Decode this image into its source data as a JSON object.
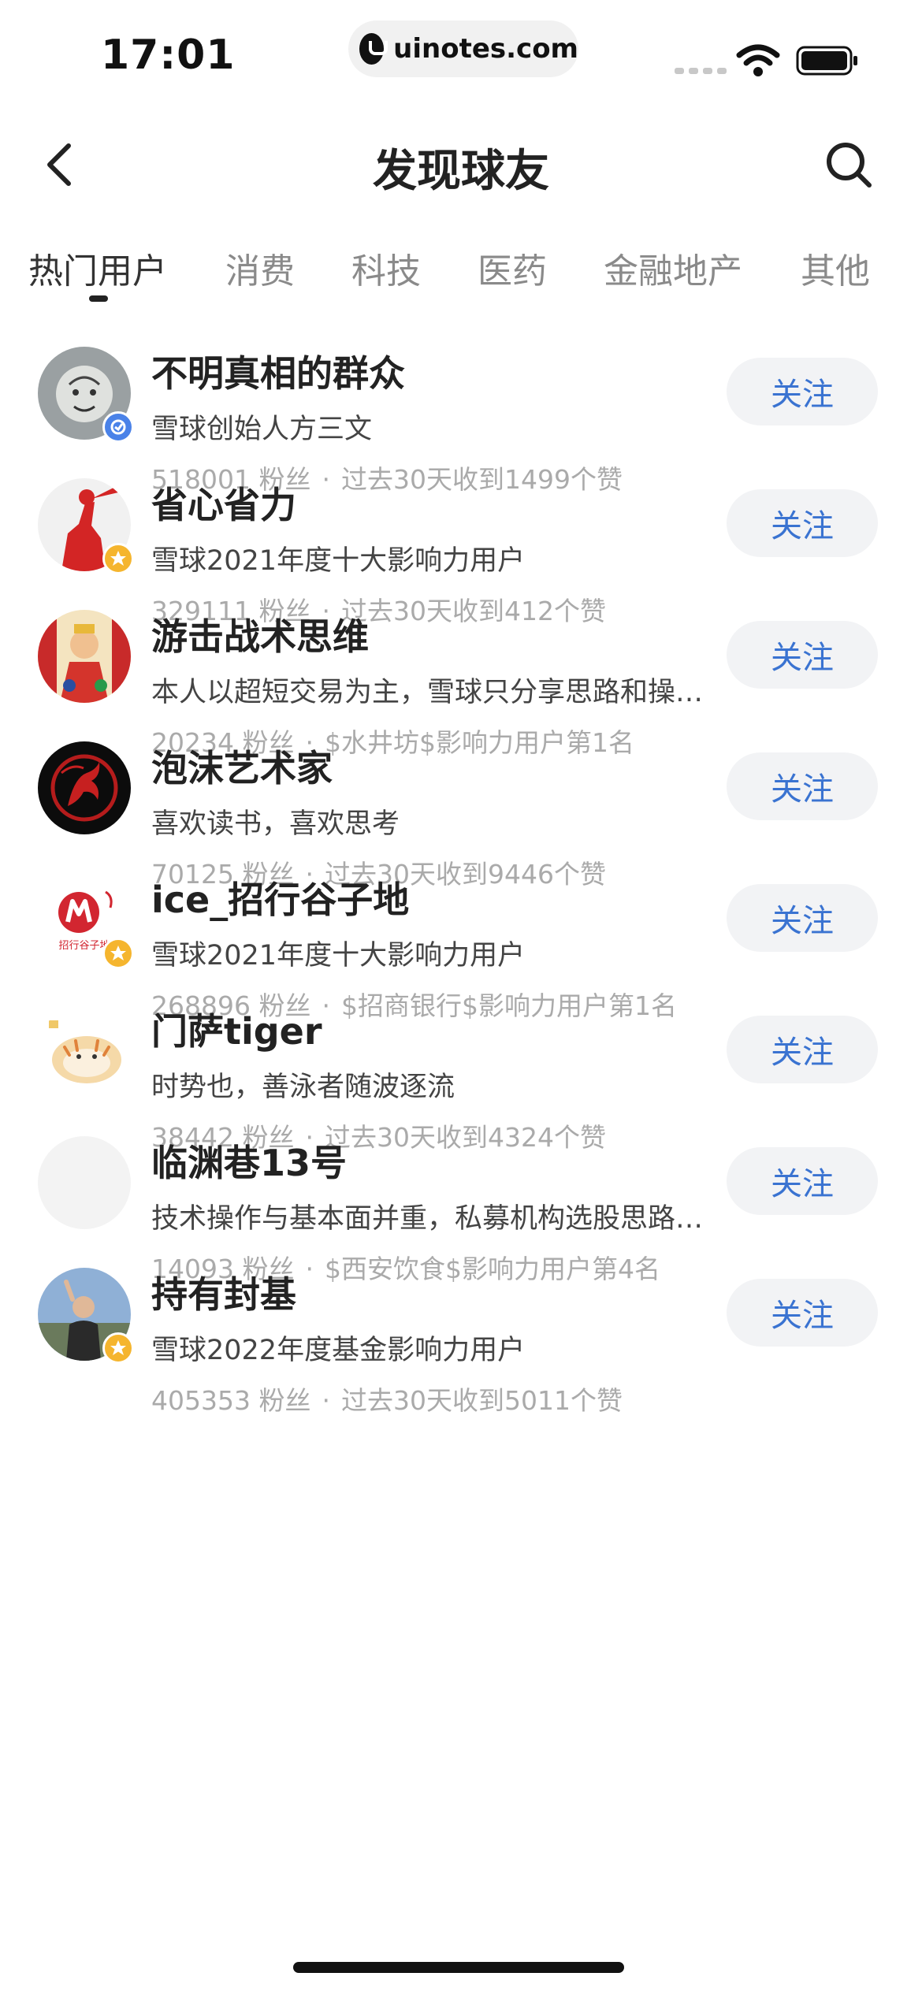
{
  "status_bar": {
    "time": "17:01",
    "url": "uinotes.com"
  },
  "nav": {
    "title": "发现球友"
  },
  "tabs": [
    {
      "label": "热门用户",
      "active": true
    },
    {
      "label": "消费",
      "active": false
    },
    {
      "label": "科技",
      "active": false
    },
    {
      "label": "医药",
      "active": false
    },
    {
      "label": "金融地产",
      "active": false
    },
    {
      "label": "其他",
      "active": false
    }
  ],
  "follow_label": "关注",
  "fans_unit": "粉丝",
  "users": [
    {
      "name": "不明真相的群众",
      "desc": "雪球创始人方三文",
      "fans": "518001",
      "meta": "过去30天收到1499个赞",
      "badge": "verified",
      "avatar": "sketch-face"
    },
    {
      "name": "省心省力",
      "desc": "雪球2021年度十大影响力用户",
      "fans": "329111",
      "meta": "过去30天收到412个赞",
      "badge": "star",
      "avatar": "red-figure"
    },
    {
      "name": "游击战术思维",
      "desc": "本人以超短交易为主，雪球只分享思路和操作，不做任何推荐",
      "fans": "20234",
      "meta": "$水井坊$影响力用户第1名",
      "badge": "",
      "avatar": "colorful-art"
    },
    {
      "name": "泡沫艺术家",
      "desc": "喜欢读书，喜欢思考",
      "fans": "70125",
      "meta": "过去30天收到9446个赞",
      "badge": "",
      "avatar": "red-bird"
    },
    {
      "name": "ice_招行谷子地",
      "desc": "雪球2021年度十大影响力用户",
      "fans": "268896",
      "meta": "$招商银行$影响力用户第1名",
      "badge": "star",
      "avatar": "cmb-logo",
      "avatar_text": "招行谷子地"
    },
    {
      "name": "门萨tiger",
      "desc": "时势也，善泳者随波逐流",
      "fans": "38442",
      "meta": "过去30天收到4324个赞",
      "badge": "",
      "avatar": "tiger"
    },
    {
      "name": "临渊巷13号",
      "desc": "技术操作与基本面并重，私募机构选股思路分享",
      "fans": "14093",
      "meta": "$西安饮食$影响力用户第4名",
      "badge": "",
      "avatar": "blank"
    },
    {
      "name": "持有封基",
      "desc": "雪球2022年度基金影响力用户",
      "fans": "405353",
      "meta": "过去30天收到5011个赞",
      "badge": "star",
      "avatar": "man-photo"
    }
  ]
}
